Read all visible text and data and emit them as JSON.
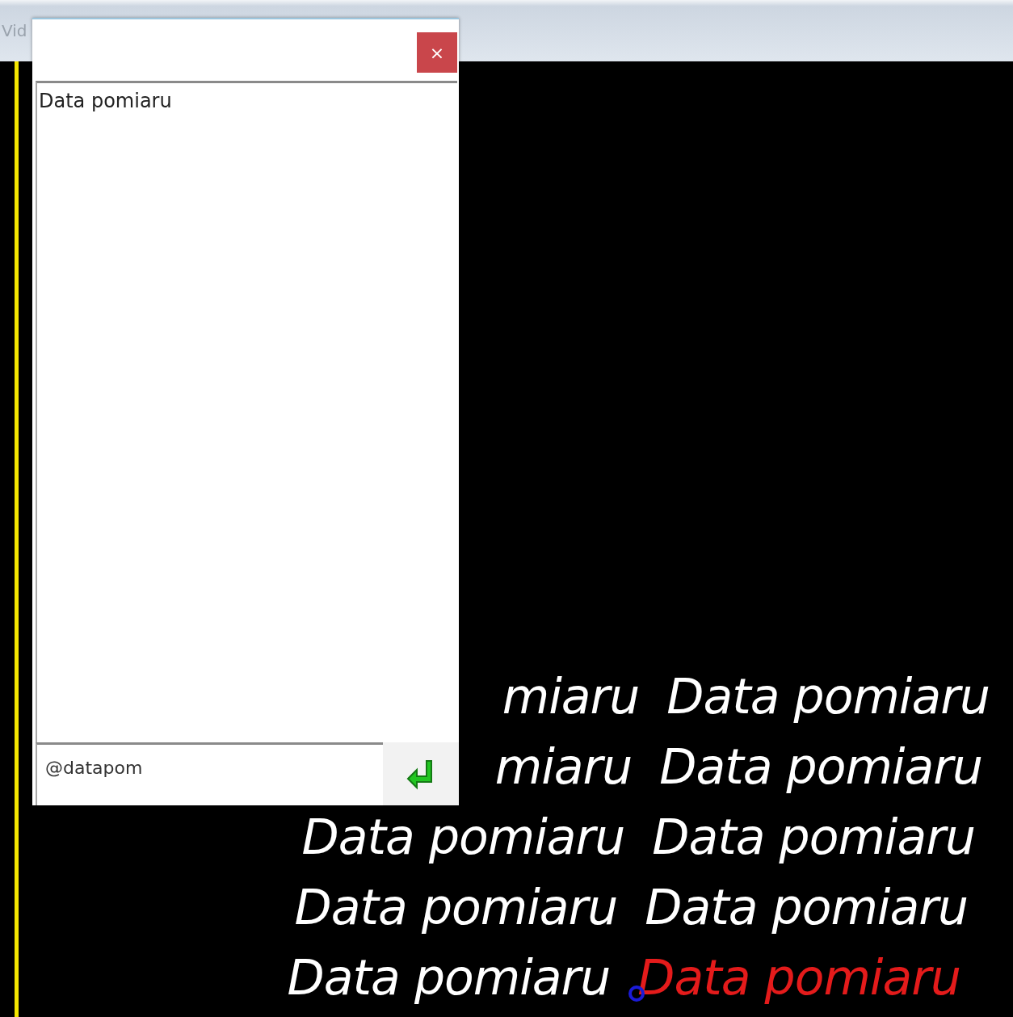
{
  "window": {
    "title": "Vid"
  },
  "dialog": {
    "close_button": "×",
    "list_items": [
      "Data pomiaru"
    ],
    "command_input": {
      "value": "@datapom"
    }
  },
  "canvas": {
    "rows": [
      {
        "texts": [
          {
            "text": "miaru",
            "selected": false
          },
          {
            "text": "Data pomiaru",
            "selected": false
          }
        ]
      },
      {
        "texts": [
          {
            "text": "miaru",
            "selected": false
          },
          {
            "text": "Data pomiaru",
            "selected": false
          }
        ]
      },
      {
        "texts": [
          {
            "text": "Data pomiaru",
            "selected": false
          },
          {
            "text": "Data pomiaru",
            "selected": false
          }
        ]
      },
      {
        "texts": [
          {
            "text": "Data pomiaru",
            "selected": false
          },
          {
            "text": "Data pomiaru",
            "selected": false
          }
        ]
      },
      {
        "texts": [
          {
            "text": "Data pomiaru",
            "selected": false
          },
          {
            "text": "Data pomiaru",
            "selected": true
          }
        ]
      }
    ]
  }
}
